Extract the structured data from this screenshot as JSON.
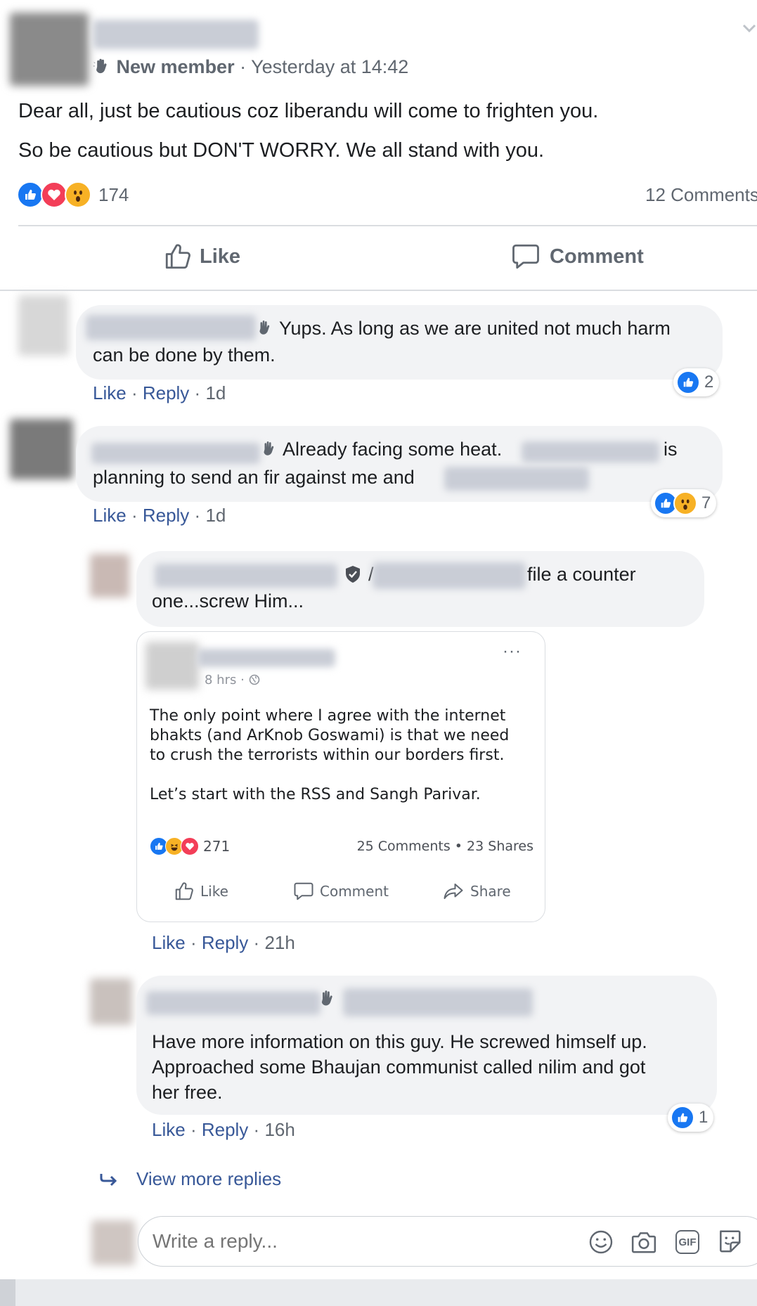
{
  "post": {
    "badge": "New member",
    "timestamp": "Yesterday at 14:42",
    "separator": "·",
    "lines": [
      "Dear all, just be cautious coz liberandu will come to frighten you.",
      "So be cautious but DON'T WORRY. We all stand with you."
    ],
    "reaction_count": "174",
    "comments_count": "12 Comments",
    "reactions": [
      "like",
      "love",
      "wow"
    ]
  },
  "actions": {
    "like": "Like",
    "comment": "Comment"
  },
  "comments": [
    {
      "line1": "Yups. As long as we are united not much harm",
      "line2": "can be done by them.",
      "like": "Like",
      "reply": "Reply",
      "time": "1d",
      "reaction_count": "2"
    },
    {
      "line1a": "Already facing some heat.",
      "line1b": "is",
      "line2": "planning to send an fir against me and",
      "like": "Like",
      "reply": "Reply",
      "time": "1d",
      "reaction_count": "7"
    }
  ],
  "reply1": {
    "line1a": "/",
    "line1b": "file a counter",
    "line2": "one...screw Him...",
    "like": "Like",
    "reply": "Reply",
    "time": "21h",
    "shared": {
      "time": "8 hrs",
      "dot": "·",
      "more": "···",
      "text_lines": [
        "The only point where I agree with the internet",
        "bhakts (and ArKnob Goswami) is that we need",
        "to crush the terrorists within our borders first.",
        "Let’s start with the RSS and Sangh Parivar."
      ],
      "reaction_count": "271",
      "stats": "25 Comments • 23 Shares",
      "like": "Like",
      "comment": "Comment",
      "share": "Share"
    }
  },
  "reply2": {
    "lines": [
      "Have more information on this guy. He screwed himself up.",
      "Approached some Bhaujan communist called nilim and got",
      "her free."
    ],
    "like": "Like",
    "reply": "Reply",
    "time": "16h",
    "reaction_count": "1"
  },
  "view_more": "View more replies",
  "composer": {
    "placeholder": "Write a reply...",
    "gif": "GIF"
  },
  "colors": {
    "link": "#385898",
    "muted": "#606770",
    "bubble": "#f2f3f5",
    "like_blue": "#1877f2",
    "love_red": "#f33e58",
    "wow_yellow": "#f7b125"
  }
}
